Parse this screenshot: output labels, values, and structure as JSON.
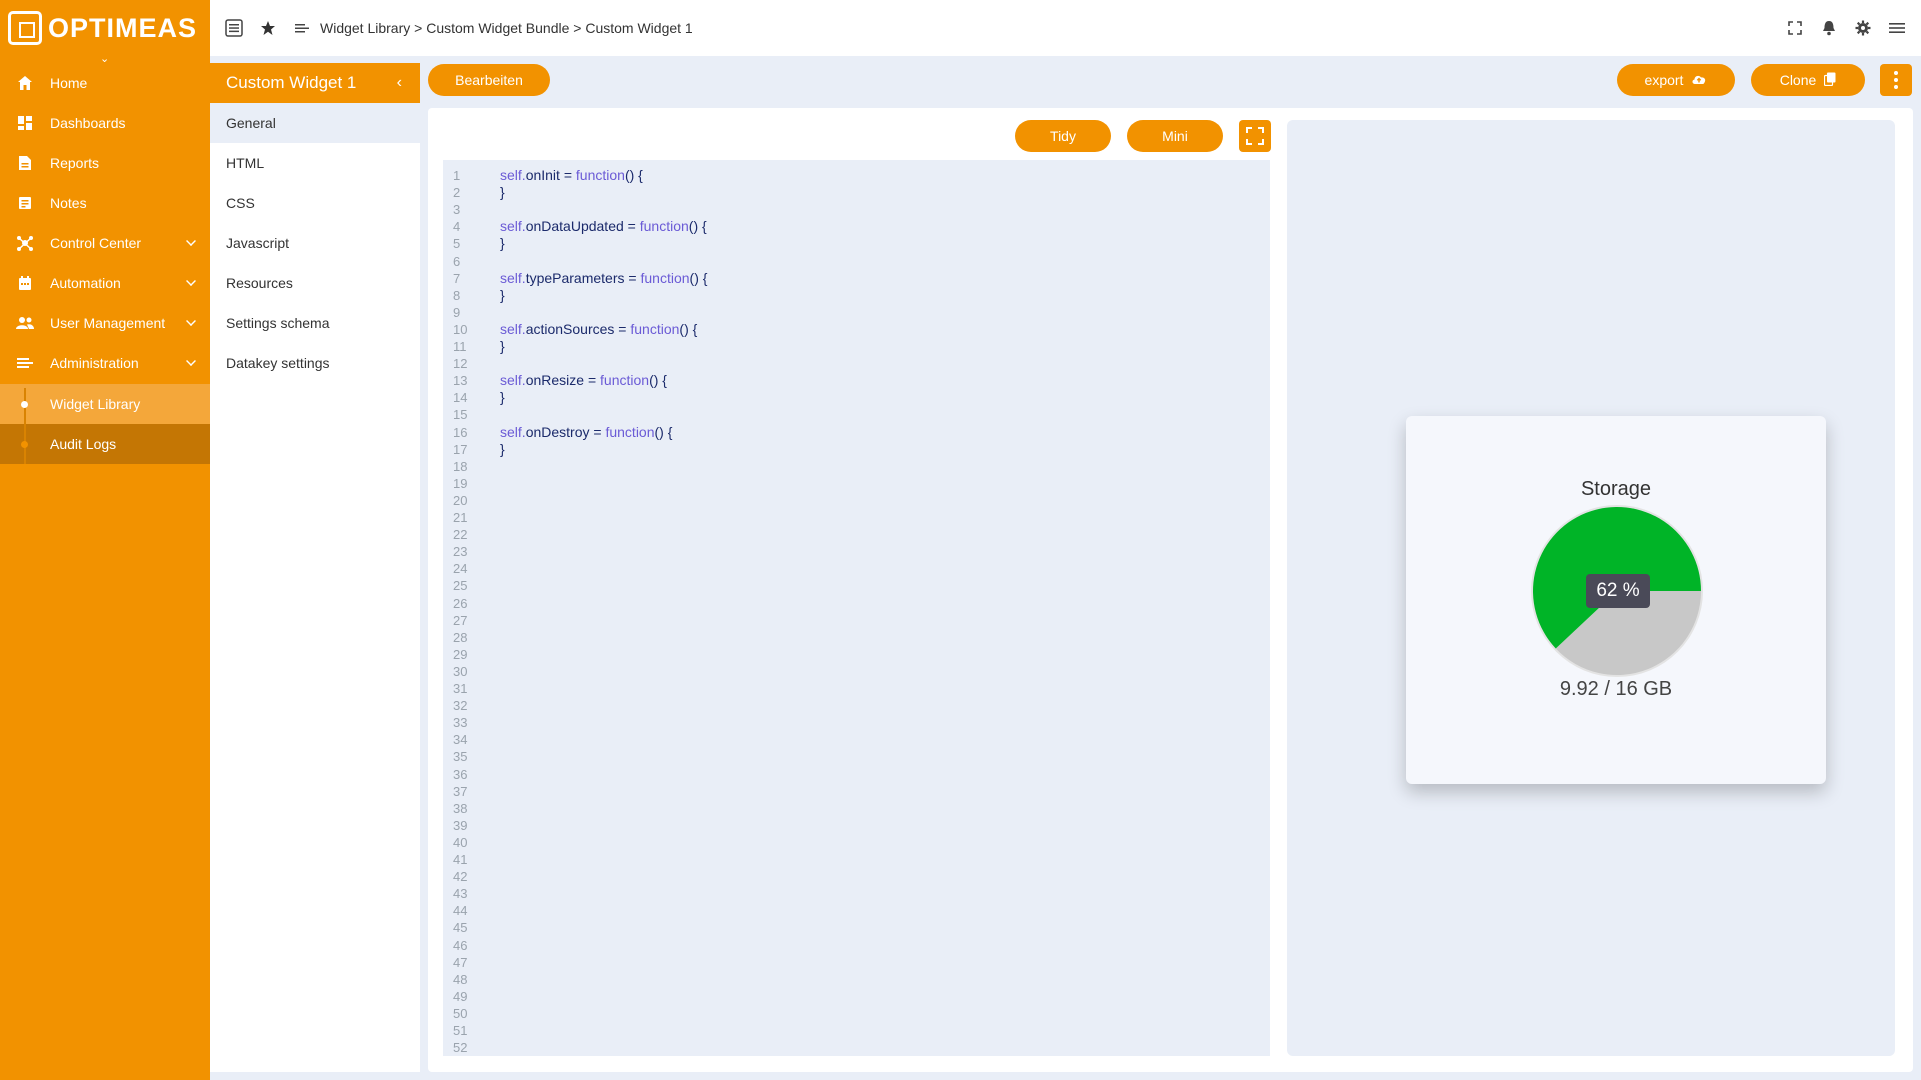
{
  "app": {
    "brand": "OPTIMEAS"
  },
  "sidebar": {
    "items": [
      {
        "label": "Home",
        "icon": "home-icon"
      },
      {
        "label": "Dashboards",
        "icon": "dashboard-icon"
      },
      {
        "label": "Reports",
        "icon": "report-icon"
      },
      {
        "label": "Notes",
        "icon": "notes-icon"
      },
      {
        "label": "Control Center",
        "icon": "hub-icon"
      },
      {
        "label": "Automation",
        "icon": "calendar-icon"
      },
      {
        "label": "User Management",
        "icon": "users-icon"
      },
      {
        "label": "Administration",
        "icon": "list-icon"
      },
      {
        "label": "Widget Library",
        "icon": "dot"
      },
      {
        "label": "Audit Logs",
        "icon": "dot"
      }
    ]
  },
  "topbar": {
    "breadcrumb": "Widget Library > Custom Widget Bundle > Custom Widget 1"
  },
  "subpanel": {
    "title": "Custom Widget 1",
    "items": [
      "General",
      "HTML",
      "CSS",
      "Javascript",
      "Resources",
      "Settings schema",
      "Datakey settings"
    ]
  },
  "toolbar": {
    "edit": "Bearbeiten",
    "export": "export",
    "clone": "Clone",
    "tidy": "Tidy",
    "mini": "Mini"
  },
  "editor": {
    "line_count": 52,
    "code": [
      {
        "line": 1,
        "obj": "self.",
        "prop": "onInit",
        "kw": "function",
        "rest": "() {"
      },
      {
        "line": 2,
        "text": "}"
      },
      {
        "line": 4,
        "obj": "self.",
        "prop": "onDataUpdated",
        "kw": "function",
        "rest": "() {"
      },
      {
        "line": 5,
        "text": "}"
      },
      {
        "line": 7,
        "obj": "self.",
        "prop": "typeParameters",
        "kw": "function",
        "rest": "() {"
      },
      {
        "line": 8,
        "text": "}"
      },
      {
        "line": 10,
        "obj": "self.",
        "prop": "actionSources",
        "kw": "function",
        "rest": "() {"
      },
      {
        "line": 11,
        "text": "}"
      },
      {
        "line": 13,
        "obj": "self.",
        "prop": "onResize",
        "kw": "function",
        "rest": "() {"
      },
      {
        "line": 14,
        "text": "}"
      },
      {
        "line": 16,
        "obj": "self.",
        "prop": "onDestroy",
        "kw": "function",
        "rest": "() {"
      },
      {
        "line": 17,
        "text": "}"
      }
    ]
  },
  "widget": {
    "title": "Storage",
    "percent_label": "62 %",
    "value_label": "9.92 / 16 GB",
    "used_fraction": 0.62,
    "used_color": "#00b427",
    "free_color": "#c8c8c8"
  },
  "colors": {
    "accent": "#f29200"
  }
}
